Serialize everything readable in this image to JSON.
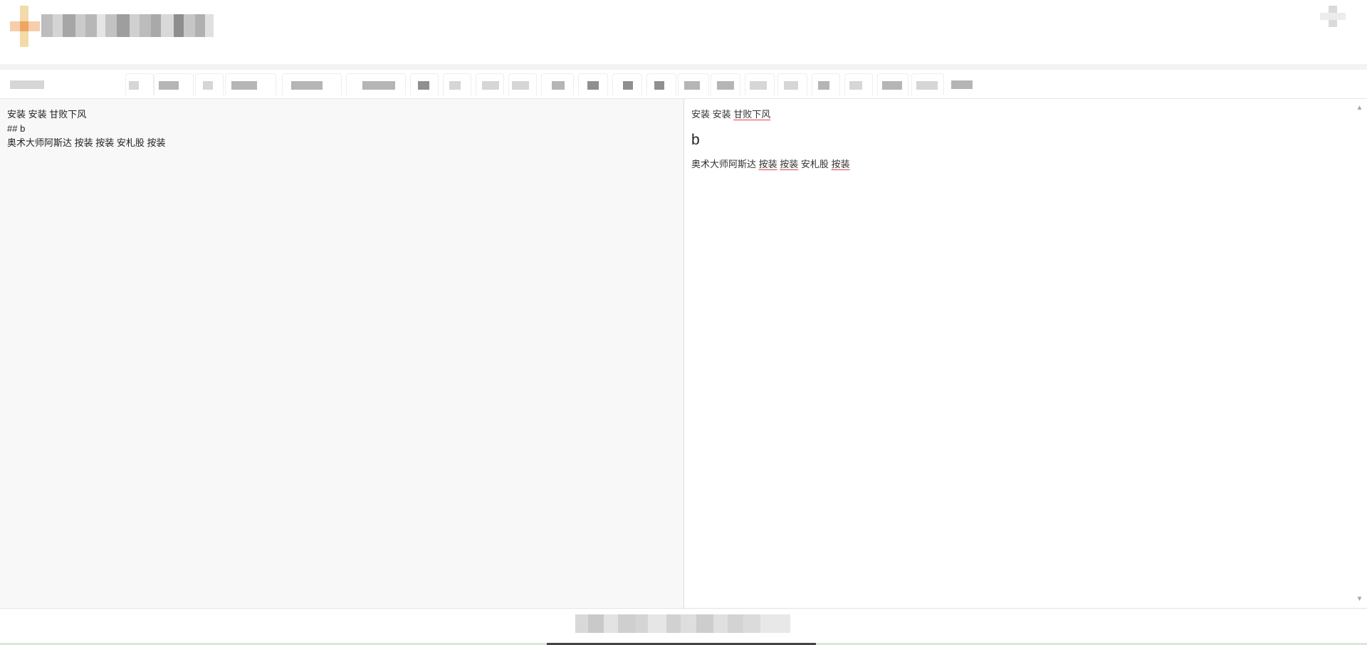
{
  "app": {
    "logo_icon": "app-logo-icon",
    "title": ""
  },
  "header": {
    "user_menu_icon": "user-menu-icon"
  },
  "toolbar": {
    "buttons": [
      {
        "name": "paragraph-select",
        "icon": "format-dropdown-icon"
      },
      {
        "name": "bold-button",
        "icon": "bold-icon"
      },
      {
        "name": "italic-button",
        "icon": "italic-icon"
      },
      {
        "name": "strikethrough-button",
        "icon": "strikethrough-icon"
      },
      {
        "name": "heading-button",
        "icon": "heading-icon"
      },
      {
        "name": "quote-button",
        "icon": "quote-icon"
      },
      {
        "name": "unordered-list-button",
        "icon": "bullet-list-icon"
      },
      {
        "name": "ordered-list-button",
        "icon": "numbered-list-icon"
      },
      {
        "name": "code-button",
        "icon": "code-icon"
      },
      {
        "name": "link-button",
        "icon": "link-icon"
      },
      {
        "name": "image-button",
        "icon": "image-icon"
      },
      {
        "name": "table-button",
        "icon": "table-icon"
      },
      {
        "name": "hr-button",
        "icon": "horizontal-rule-icon"
      },
      {
        "name": "undo-button",
        "icon": "undo-icon"
      },
      {
        "name": "redo-button",
        "icon": "redo-icon"
      },
      {
        "name": "preview-button",
        "icon": "eye-icon"
      },
      {
        "name": "side-by-side-button",
        "icon": "columns-icon"
      },
      {
        "name": "fullscreen-button",
        "icon": "fullscreen-icon"
      },
      {
        "name": "help-button",
        "icon": "question-icon"
      }
    ]
  },
  "editor": {
    "lines": [
      "安装 安装 甘败下风",
      "## b",
      "奥术大师阿斯达 按装 按装 安札股 按装"
    ]
  },
  "preview": {
    "p1": {
      "w1": "安装",
      "w2": "安装",
      "w3": "甘败下风"
    },
    "heading": "b",
    "p2": {
      "w1": "奥术大师阿斯达",
      "w2": "按装",
      "w3": "按装",
      "w4": "安札股",
      "w5": "按装"
    }
  },
  "scrollbar": {
    "up": "▲",
    "down": "▼"
  },
  "colors": {
    "editor_bg": "#f8f8f8",
    "preview_bg": "#ffffff",
    "spellcheck": "#e0464b",
    "border": "#dcdcdc"
  }
}
